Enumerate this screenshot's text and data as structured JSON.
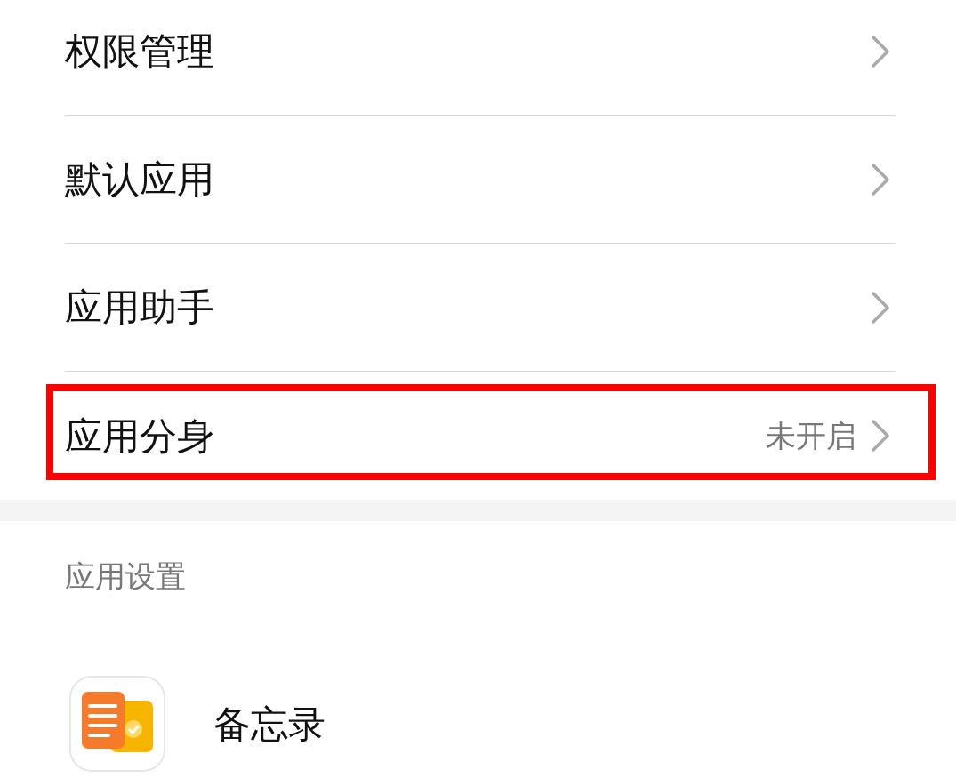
{
  "menu_items": [
    {
      "label": "权限管理",
      "highlighted": false
    },
    {
      "label": "默认应用",
      "highlighted": false
    },
    {
      "label": "应用助手",
      "highlighted": false
    },
    {
      "label": "应用分身",
      "value": "未开启",
      "highlighted": true
    }
  ],
  "section": {
    "title": "应用设置",
    "apps": [
      {
        "name": "备忘录"
      }
    ]
  }
}
